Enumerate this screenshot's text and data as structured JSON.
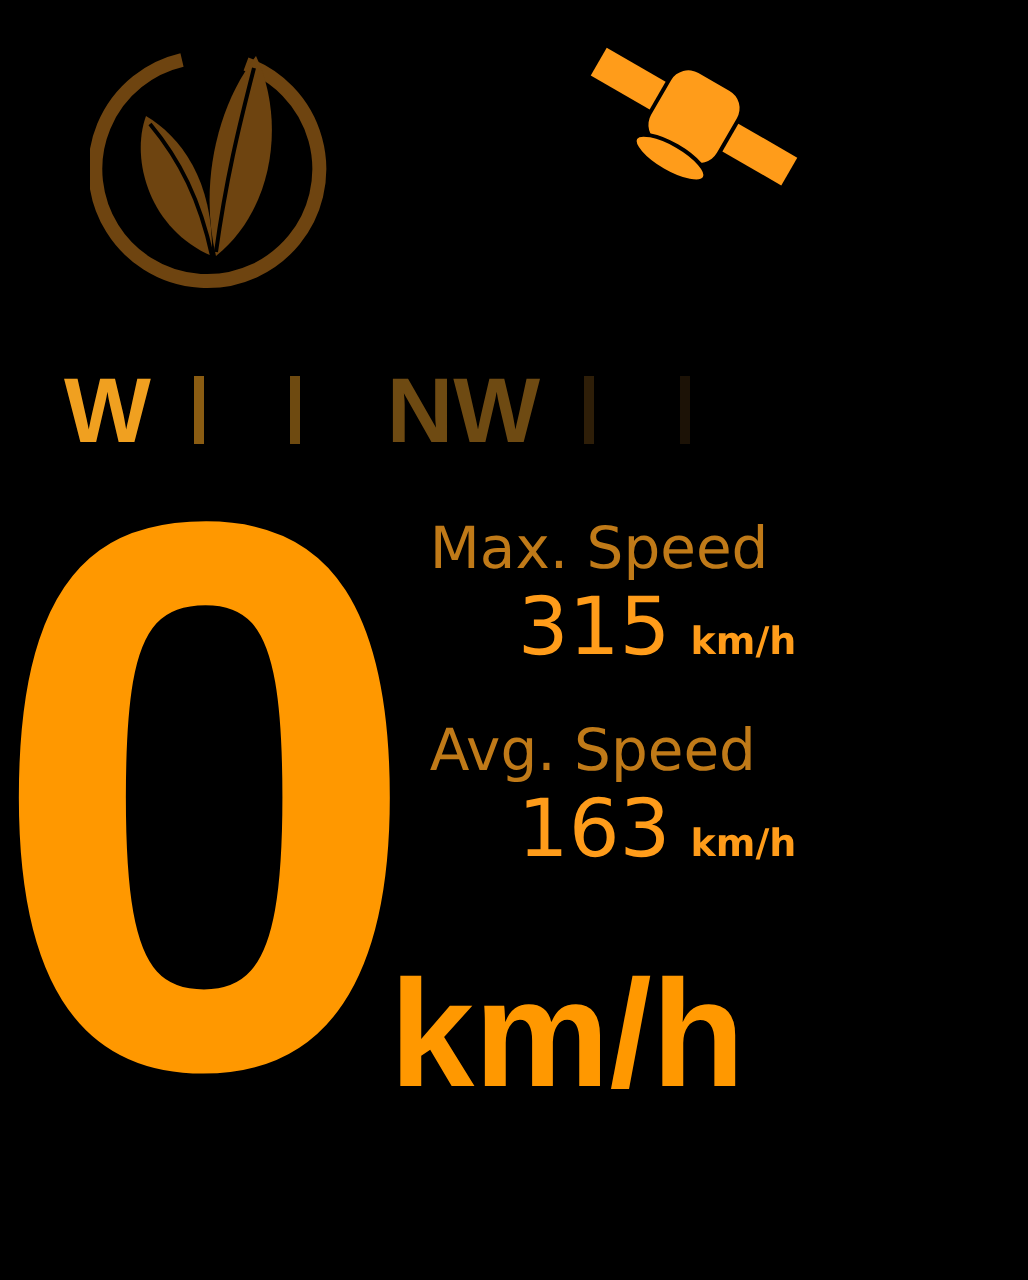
{
  "compass": [
    {
      "kind": "label",
      "text": "W",
      "color": "#f0a020"
    },
    {
      "kind": "tick",
      "color": "#8a5c12"
    },
    {
      "kind": "tick",
      "color": "#6e4a10"
    },
    {
      "kind": "label",
      "text": "NW",
      "color": "#6e4a12"
    },
    {
      "kind": "tick",
      "color": "#2e1e08"
    },
    {
      "kind": "tick",
      "color": "#1c1206"
    }
  ],
  "speed": {
    "value": "0",
    "unit": "km/h"
  },
  "stats": [
    {
      "label": "Max. Speed",
      "value": "315",
      "unit": "km/h"
    },
    {
      "label": "Avg. Speed",
      "value": "163",
      "unit": "km/h"
    }
  ]
}
